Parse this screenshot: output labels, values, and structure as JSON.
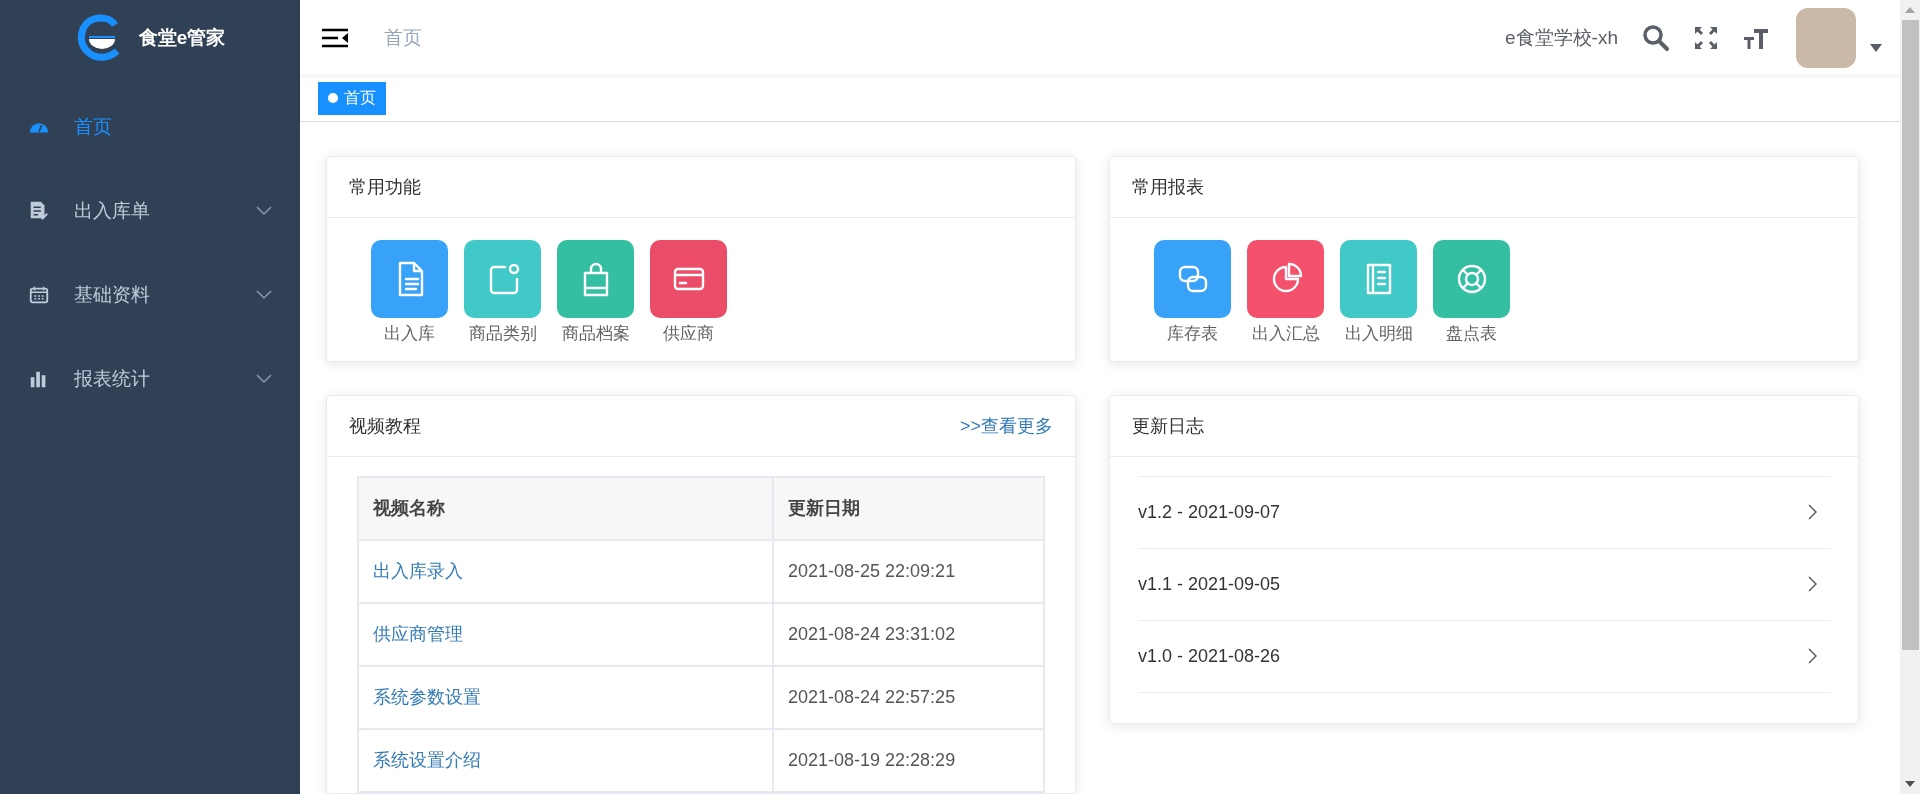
{
  "sidebar": {
    "logo_text": "食堂e管家",
    "items": [
      {
        "label": "首页",
        "selected": true
      },
      {
        "label": "出入库单",
        "selected": false,
        "expanded": false
      },
      {
        "label": "基础资料",
        "selected": false,
        "expanded": false
      },
      {
        "label": "报表统计",
        "selected": false,
        "expanded": false
      }
    ]
  },
  "header": {
    "breadcrumb": "首页",
    "school": "e食堂学校-xh"
  },
  "tags": [
    {
      "label": "首页",
      "selected": true
    }
  ],
  "common_functions": {
    "title": "常用功能",
    "items": [
      {
        "label": "出入库",
        "color": "#37a2f7"
      },
      {
        "label": "商品类别",
        "color": "#40c9c6"
      },
      {
        "label": "商品档案",
        "color": "#34bfa3"
      },
      {
        "label": "供应商",
        "color": "#eb4c68"
      }
    ]
  },
  "common_reports": {
    "title": "常用报表",
    "items": [
      {
        "label": "库存表",
        "color": "#37a2f7"
      },
      {
        "label": "出入汇总",
        "color": "#f4516c"
      },
      {
        "label": "出入明细",
        "color": "#40c9c6"
      },
      {
        "label": "盘点表",
        "color": "#34bfa3"
      }
    ]
  },
  "video_tutorials": {
    "title": "视频教程",
    "more_link": ">>查看更多",
    "columns": [
      "视频名称",
      "更新日期"
    ],
    "rows": [
      [
        "出入库录入",
        "2021-08-25 22:09:21"
      ],
      [
        "供应商管理",
        "2021-08-24 23:31:02"
      ],
      [
        "系统参数设置",
        "2021-08-24 22:57:25"
      ],
      [
        "系统设置介绍",
        "2021-08-19 22:28:29"
      ]
    ]
  },
  "update_log": {
    "title": "更新日志",
    "items": [
      "v1.2 - 2021-09-07",
      "v1.1 - 2021-09-05",
      "v1.0 - 2021-08-26"
    ]
  }
}
